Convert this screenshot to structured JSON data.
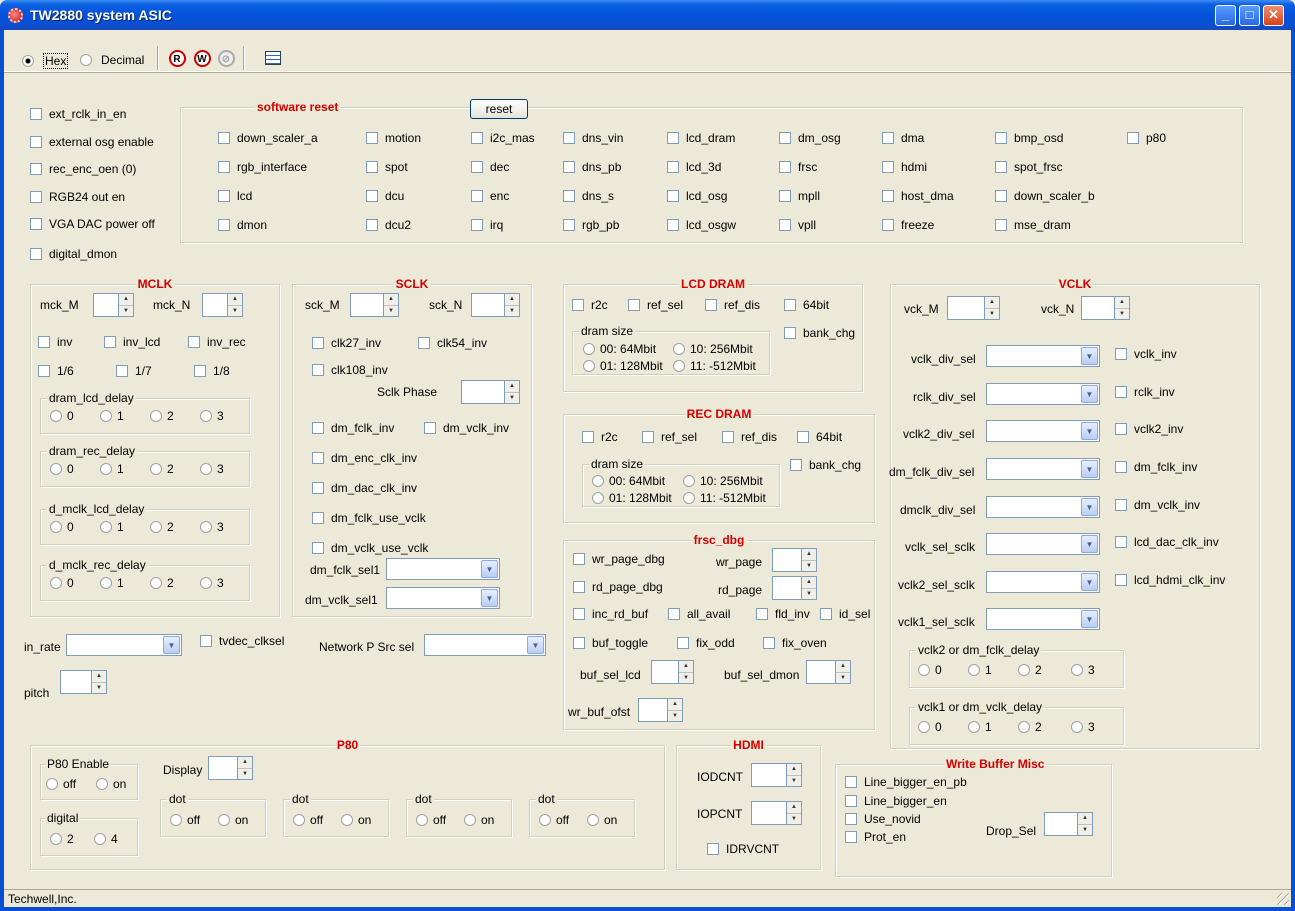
{
  "window": {
    "title": "TW2880 system ASIC"
  },
  "toolbar": {
    "hex_label": "Hex",
    "decimal_label": "Decimal"
  },
  "status_bar": {
    "text": "Techwell,Inc."
  },
  "left_checks": [
    "ext_rclk_in_en",
    "external osg enable",
    "rec_enc_oen (0)",
    "RGB24 out en",
    "VGA DAC power off",
    "digital_dmon"
  ],
  "software_reset": {
    "title": "software reset",
    "button": "reset",
    "rows": [
      [
        "down_scaler_a",
        "motion",
        "i2c_mas",
        "dns_vin",
        "lcd_dram",
        "dm_osg",
        "dma",
        "bmp_osd",
        "p80"
      ],
      [
        "rgb_interface",
        "spot",
        "dec",
        "dns_pb",
        "lcd_3d",
        "frsc",
        "hdmi",
        "spot_frsc"
      ],
      [
        "lcd",
        "dcu",
        "enc",
        "dns_s",
        "lcd_osg",
        "mpll",
        "host_dma",
        "down_scaler_b"
      ],
      [
        "dmon",
        "dcu2",
        "irq",
        "rgb_pb",
        "lcd_osgw",
        "vpll",
        "freeze",
        "mse_dram"
      ]
    ]
  },
  "mclk": {
    "title": "MCLK",
    "m_label": "mck_M",
    "n_label": "mck_N",
    "checks": [
      "inv",
      "inv_lcd",
      "inv_rec",
      "1/6",
      "1/7",
      "1/8"
    ],
    "delays": [
      "dram_lcd_delay",
      "dram_rec_delay",
      "d_mclk_lcd_delay",
      "d_mclk_rec_delay"
    ],
    "options": [
      "0",
      "1",
      "2",
      "3"
    ]
  },
  "sclk": {
    "title": "SCLK",
    "m_label": "sck_M",
    "n_label": "sck_N",
    "checks_top": [
      "clk27_inv",
      "clk54_inv",
      "clk108_inv"
    ],
    "phase_label": "Sclk Phase",
    "checks_mid": [
      "dm_fclk_inv",
      "dm_vclk_inv",
      "dm_enc_clk_inv",
      "dm_dac_clk_inv",
      "dm_fclk_use_vclk",
      "dm_vclk_use_vclk"
    ],
    "sel1": "dm_fclk_sel1",
    "sel2": "dm_vclk_sel1"
  },
  "lcd_dram": {
    "title": "LCD DRAM",
    "checks": [
      "r2c",
      "ref_sel",
      "ref_dis",
      "64bit",
      "bank_chg"
    ],
    "size_title": "dram size",
    "sizes": [
      "00: 64Mbit",
      "10: 256Mbit",
      "01: 128Mbit",
      "11: -512Mbit"
    ]
  },
  "rec_dram": {
    "title": "REC DRAM",
    "checks": [
      "r2c",
      "ref_sel",
      "ref_dis",
      "64bit",
      "bank_chg"
    ],
    "size_title": "dram size",
    "sizes": [
      "00: 64Mbit",
      "10: 256Mbit",
      "01: 128Mbit",
      "11: -512Mbit"
    ]
  },
  "frsc_dbg": {
    "title": "frsc_dbg",
    "wr_page_dbg": "wr_page_dbg",
    "wr_page": "wr_page",
    "rd_page_dbg": "rd_page_dbg",
    "rd_page": "rd_page",
    "row3": [
      "inc_rd_buf",
      "all_avail",
      "fld_inv",
      "id_sel"
    ],
    "row4": [
      "buf_toggle",
      "fix_odd",
      "fix_oven"
    ],
    "buf_sel_lcd": "buf_sel_lcd",
    "buf_sel_dmon": "buf_sel_dmon",
    "wr_buf_ofst": "wr_buf_ofst"
  },
  "vclk": {
    "title": "VCLK",
    "m_label": "vck_M",
    "n_label": "vck_N",
    "selects": [
      "vclk_div_sel",
      "rclk_div_sel",
      "vclk2_div_sel",
      "dm_fclk_div_sel",
      "dmclk_div_sel",
      "vclk_sel_sclk",
      "vclk2_sel_sclk",
      "vclk1_sel_sclk"
    ],
    "checks": [
      "vclk_inv",
      "rclk_inv",
      "vclk2_inv",
      "dm_fclk_inv",
      "dm_vclk_inv",
      "lcd_dac_clk_inv",
      "lcd_hdmi_clk_inv"
    ],
    "delay1": "vclk2 or dm_fclk_delay",
    "delay2": "vclk1 or dm_vclk_delay",
    "options": [
      "0",
      "1",
      "2",
      "3"
    ]
  },
  "misc": {
    "in_rate": "in_rate",
    "tvdec": "tvdec_clksel",
    "network": "Network P Src sel",
    "pitch": "pitch"
  },
  "p80": {
    "title": "P80",
    "enable": "P80 Enable",
    "off": "off",
    "on": "on",
    "display": "Display",
    "digital": "digital",
    "d2": "2",
    "d4": "4",
    "dot": "dot"
  },
  "hdmi": {
    "title": "HDMI",
    "iodcnt": "IODCNT",
    "iopcnt": "IOPCNT",
    "idrvcnt": "IDRVCNT"
  },
  "wbm": {
    "title": "Write Buffer Misc",
    "checks": [
      "Line_bigger_en_pb",
      "Line_bigger_en",
      "Use_novid",
      "Prot_en"
    ],
    "drop": "Drop_Sel"
  }
}
